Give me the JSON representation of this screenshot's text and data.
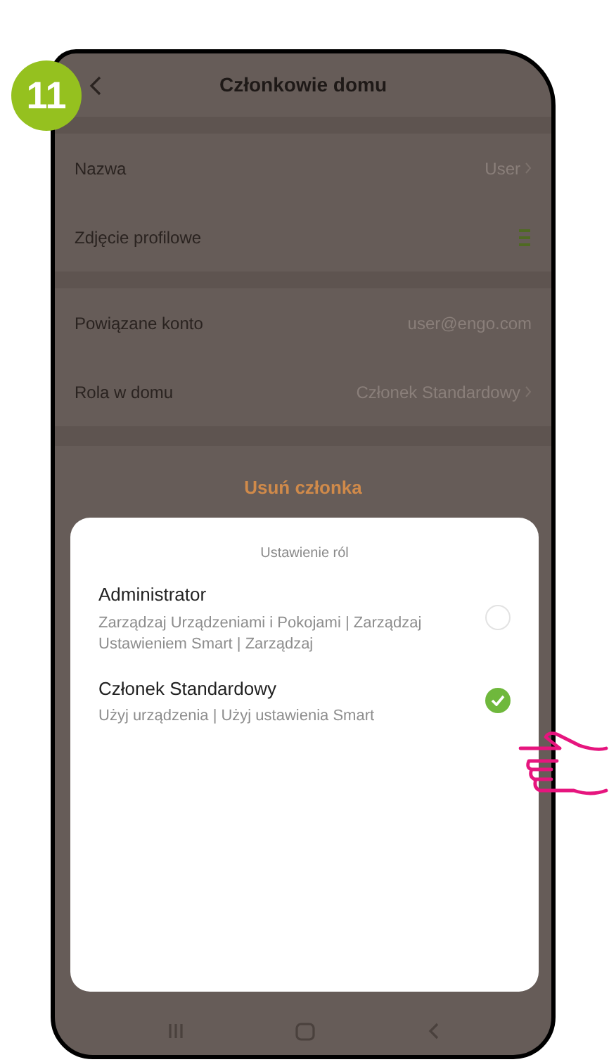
{
  "step_badge": "11",
  "header": {
    "title": "Członkowie domu"
  },
  "groups": [
    {
      "rows": [
        {
          "label": "Nazwa",
          "value": "User",
          "kind": "link"
        },
        {
          "label": "Zdjęcie profilowe",
          "kind": "avatar"
        }
      ]
    },
    {
      "rows": [
        {
          "label": "Powiązane konto",
          "value": "user@engo.com",
          "kind": "plain"
        },
        {
          "label": "Rola w domu",
          "value": "Członek Standardowy",
          "kind": "link"
        }
      ]
    }
  ],
  "remove_button": "Usuń członka",
  "role_dialog": {
    "title": "Ustawienie ról",
    "options": [
      {
        "name": "Administrator",
        "description": "Zarządzaj Urządzeniami i Pokojami | Zarządzaj Ustawieniem Smart | Zarządzaj",
        "selected": false
      },
      {
        "name": "Członek Standardowy",
        "description": "Użyj urządzenia | Użyj ustawienia Smart",
        "selected": true
      }
    ]
  }
}
